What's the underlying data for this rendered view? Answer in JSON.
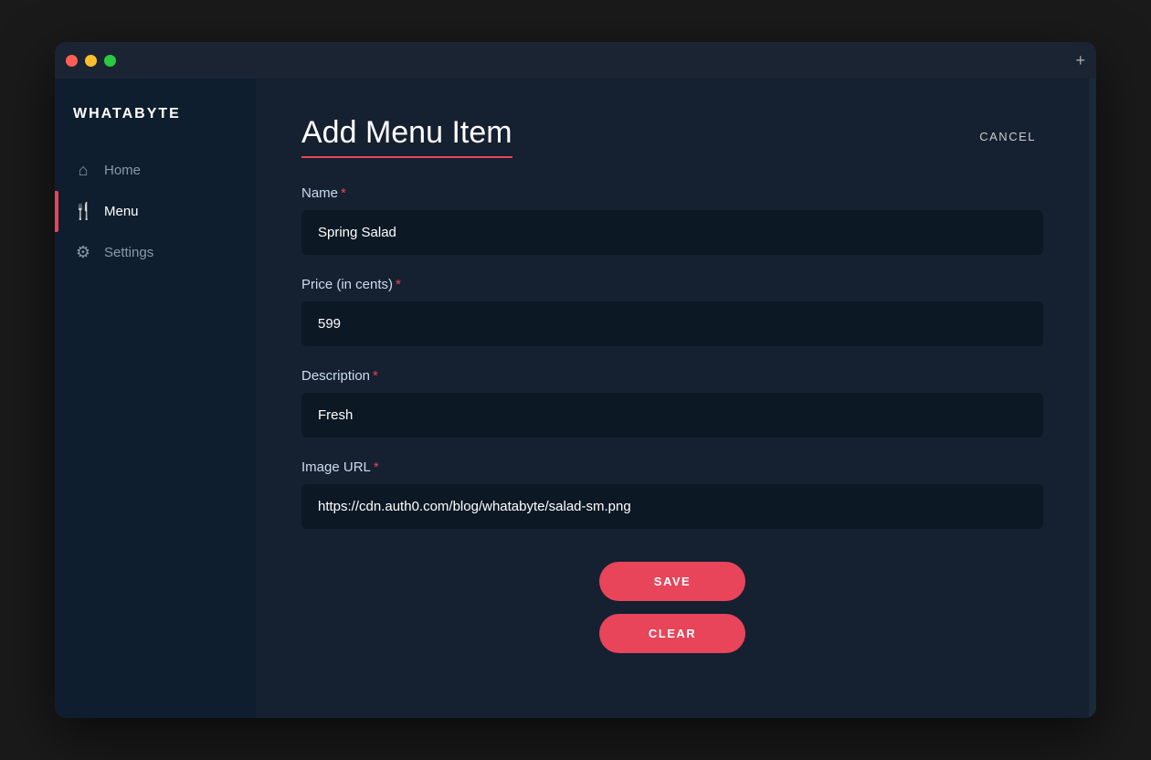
{
  "window": {
    "title": "Whatabyte"
  },
  "sidebar": {
    "logo": "WHATABYTE",
    "nav_items": [
      {
        "id": "home",
        "label": "Home",
        "icon": "⌂",
        "active": false
      },
      {
        "id": "menu",
        "label": "Menu",
        "icon": "🍴",
        "active": true
      },
      {
        "id": "settings",
        "label": "Settings",
        "icon": "⚙",
        "active": false
      }
    ]
  },
  "page": {
    "title": "Add Menu Item",
    "cancel_label": "CANCEL"
  },
  "form": {
    "name_label": "Name",
    "name_required": "*",
    "name_value": "Spring Salad",
    "name_placeholder": "Spring Salad",
    "price_label": "Price (in cents)",
    "price_required": "*",
    "price_value": "599",
    "price_placeholder": "599",
    "description_label": "Description",
    "description_required": "*",
    "description_value": "Fresh",
    "description_placeholder": "Fresh",
    "image_url_label": "Image URL",
    "image_url_required": "*",
    "image_url_value": "https://cdn.auth0.com/blog/whatabyte/salad-sm.png",
    "image_url_placeholder": "https://cdn.auth0.com/blog/whatabyte/salad-sm.png"
  },
  "buttons": {
    "save_label": "SAVE",
    "clear_label": "CLEAR"
  },
  "traffic_lights": {
    "close": "close",
    "minimize": "minimize",
    "maximize": "maximize"
  }
}
